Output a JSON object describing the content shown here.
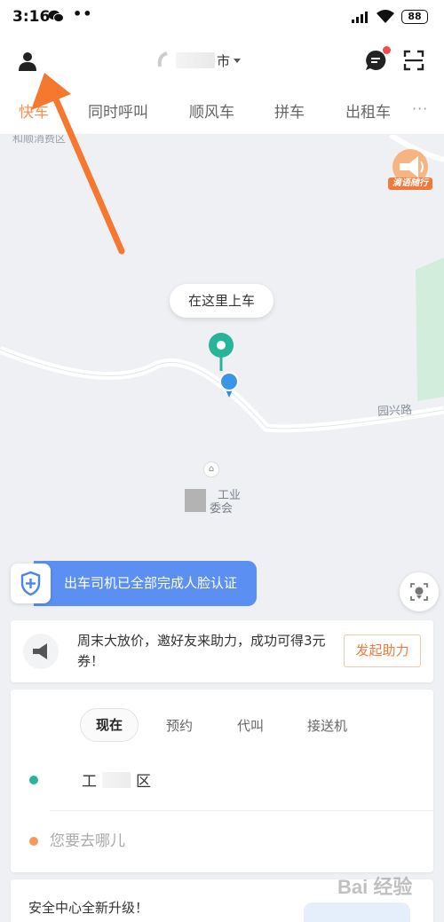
{
  "status_bar": {
    "time": "3:16",
    "extra": "••",
    "battery": "88"
  },
  "header": {
    "city": "市"
  },
  "service_tabs": [
    {
      "label": "快车",
      "active": true
    },
    {
      "label": "同时呼叫",
      "active": false
    },
    {
      "label": "顺风车",
      "active": false
    },
    {
      "label": "拼车",
      "active": false
    },
    {
      "label": "出租车",
      "active": false
    }
  ],
  "service_tabs_more": "···",
  "map": {
    "top_label": "和顺消费区",
    "badge_label": "滴语随行",
    "pickup_bubble": "在这里上车",
    "road_name": "园兴路",
    "poi_line1": "工业",
    "poi_line2": "委会"
  },
  "auth_banner": {
    "text": "出车司机已全部完成人脸认证"
  },
  "promo": {
    "text": "周末大放价，邀好友来助力，成功可得3元券！",
    "button": "发起助力"
  },
  "booking": {
    "modes": [
      {
        "label": "现在",
        "active": true
      },
      {
        "label": "预约",
        "active": false
      },
      {
        "label": "代叫",
        "active": false
      },
      {
        "label": "接送机",
        "active": false
      }
    ],
    "origin_prefix": "工",
    "origin_suffix": "区",
    "destination_placeholder": "您要去哪儿"
  },
  "safety": {
    "text": "安全中心全新升级！"
  },
  "watermark": "Bai 经验",
  "colors": {
    "accent": "#fc9153",
    "origin": "#28b498",
    "destination": "#f49a5a",
    "banner": "#5b8ff2",
    "arrow": "#f5782e"
  }
}
